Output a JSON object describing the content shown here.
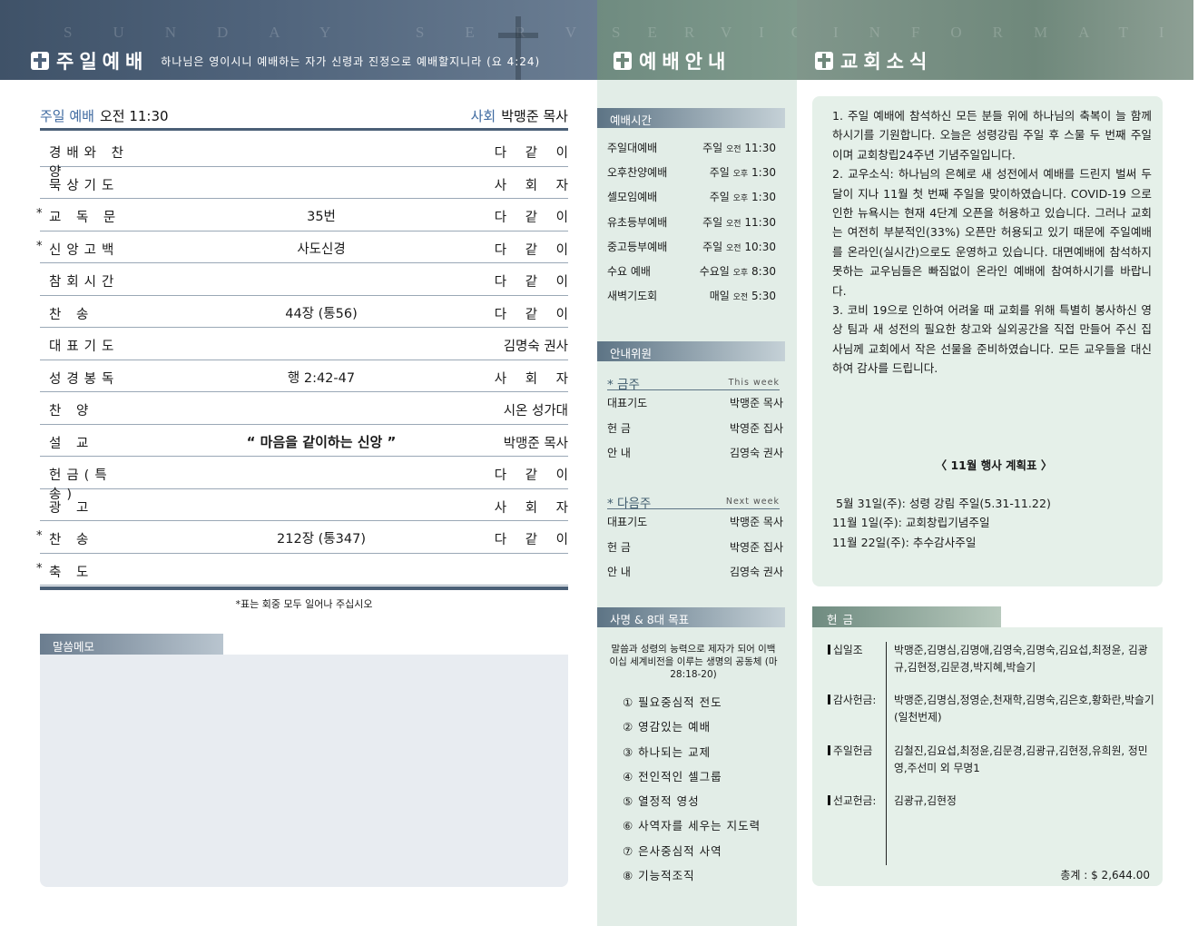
{
  "header": {
    "sunday": {
      "ghost": "SUNDAY SERVICE",
      "title": "주일예배",
      "verse": "하나님은 영이시니 예배하는 자가 신령과 진정으로 예배할지니라 (요 4:24)"
    },
    "guide": {
      "ghost": "SERVICE",
      "title": "예배안내"
    },
    "news": {
      "ghost": "INFORMATION",
      "title": "교회소식"
    }
  },
  "service": {
    "label": "주일 예배",
    "time": "오전 11:30",
    "host_label": "사회",
    "host": "박맹준 목사",
    "order": [
      {
        "star": "",
        "name": "경배와 찬양",
        "mid": "",
        "right": "다 같 이"
      },
      {
        "star": "",
        "name": "묵상기도",
        "mid": "",
        "right": "사 회 자"
      },
      {
        "star": "*",
        "name": "교  독  문",
        "mid": "35번",
        "right": "다 같 이"
      },
      {
        "star": "*",
        "name": "신앙고백",
        "mid": "사도신경",
        "right": "다 같 이"
      },
      {
        "star": "",
        "name": "참회시간",
        "mid": "",
        "right": "다 같 이"
      },
      {
        "star": "",
        "name": "찬     송",
        "mid": "44장 (통56)",
        "right": "다 같 이"
      },
      {
        "star": "",
        "name": "대표기도",
        "mid": "",
        "right": "김명숙 권사"
      },
      {
        "star": "",
        "name": "성경봉독",
        "mid": "행 2:42-47",
        "right": "사 회 자"
      },
      {
        "star": "",
        "name": "찬     양",
        "mid": "",
        "right": "시온 성가대"
      },
      {
        "star": "",
        "name": "설     교",
        "mid": "“ 마음을 같이하는 신앙 ”",
        "right": "박맹준 목사"
      },
      {
        "star": "",
        "name": "헌금(특송)",
        "mid": "",
        "right": "다 같 이"
      },
      {
        "star": "",
        "name": "광     고",
        "mid": "",
        "right": "사 회 자"
      },
      {
        "star": "*",
        "name": "찬     송",
        "mid": "212장 (통347)",
        "right": "다 같 이"
      },
      {
        "star": "*",
        "name": "축     도",
        "mid": "",
        "right": ""
      }
    ],
    "footnote": "*표는 회중 모두 일어나 주십시오",
    "memo_label": "말씀메모"
  },
  "guide": {
    "times_label": "예배시간",
    "times": [
      {
        "name": "주일대예배",
        "day": "주일",
        "ampm": "오전",
        "time": "11:30"
      },
      {
        "name": "오후찬양예배",
        "day": "주일",
        "ampm": "오후",
        "time": "1:30"
      },
      {
        "name": "셀모임예배",
        "day": "주일",
        "ampm": "오후",
        "time": "1:30"
      },
      {
        "name": "유초등부예배",
        "day": "주일",
        "ampm": "오전",
        "time": "11:30"
      },
      {
        "name": "중고등부예배",
        "day": "주일",
        "ampm": "오전",
        "time": "10:30"
      },
      {
        "name": "수요 예배",
        "day": "수요일",
        "ampm": "오후",
        "time": "8:30"
      },
      {
        "name": "새벽기도회",
        "day": "매일",
        "ampm": "오전",
        "time": "5:30"
      }
    ],
    "ushers_label": "안내위원",
    "this_week": {
      "title": "* 금주",
      "eng": "This week",
      "rows": [
        {
          "role": "대표기도",
          "name": "박맹준 목사"
        },
        {
          "role": "헌    금",
          "name": "박영준 집사"
        },
        {
          "role": "안    내",
          "name": "김영숙 권사"
        }
      ]
    },
    "next_week": {
      "title": "* 다음주",
      "eng": "Next week",
      "rows": [
        {
          "role": "대표기도",
          "name": "박맹준 목사"
        },
        {
          "role": "헌    금",
          "name": "박영준 집사"
        },
        {
          "role": "안    내",
          "name": "김영숙 권사"
        }
      ]
    },
    "mission_label": "사명 & 8대 목표",
    "mission": "말씀과 성령의 능력으로 제자가 되어 이백 이십 세계비전을 이루는 생명의 공동체 (마 28:18-20)",
    "goals": [
      "① 필요중심적 전도",
      "② 영감있는 예배",
      "③ 하나되는 교제",
      "④ 전인적인 셀그룹",
      "⑤ 열정적 영성",
      "⑥ 사역자를 세우는 지도력",
      "⑦ 은사중심적 사역",
      "⑧ 기능적조직"
    ]
  },
  "news": {
    "items": [
      "1. 주일 예배에 참석하신 모든 분들 위에 하나님의 축복이 늘 함께 하시기를 기원합니다. 오늘은 성령강림 주일 후 스물 두 번째 주일이며 교회창립24주년 기념주일입니다.",
      "2. 교우소식: 하나님의 은혜로 새 성전에서 예배를 드린지 벌써 두 달이 지나 11월 첫 번째 주일을 맞이하였습니다. COVID-19 으로 인한 뉴욕시는 현재 4단계 오픈을 허용하고 있습니다. 그러나 교회는 여전히 부분적인(33%) 오픈만 허용되고 있기 때문에 주일예배를 온라인(실시간)으로도 운영하고 있습니다. 대면예배에 참석하지 못하는 교우님들은 빠짐없이 온라인 예배에 참여하시기를 바랍니다.",
      "3. 코비 19으로 인하여 어려울 때 교회를 위해 특별히 봉사하신 영상 팀과 새 성전의 필요한 창고와 실외공간을 직접 만들어 주신 집사님께 교회에서 작은 선물을 준비하였습니다. 모든 교우들을 대신하여 감사를 드립니다."
    ],
    "plan_title": "〈 11월 행사 계획표 〉",
    "plan": [
      " 5월 31일(주): 성령 강림 주일(5.31-11.22)",
      "11월 1일(주): 교회창립기념주일",
      "11월 22일(주): 추수감사주일"
    ]
  },
  "offering": {
    "label": "헌금",
    "rows": [
      {
        "label": "십일조",
        "names": "박맹준,김명심,김명애,김영숙,김명숙,김요섭,최정윤, 김광규,김현정,김문경,박지혜,박슬기"
      },
      {
        "label": "감사헌금:",
        "names": "박맹준,김명심,정영순,천재학,김명숙,김은호,황화란,박슬기 (일천번제)"
      },
      {
        "label": "주일헌금",
        "names": "김철진,김요섭,최정윤,김문경,김광규,김현정,유희원, 정민영,주선미 외 무명1"
      },
      {
        "label": "선교헌금:",
        "names": "김광규,김현정"
      }
    ],
    "total": "총계 : $ 2,644.00"
  }
}
